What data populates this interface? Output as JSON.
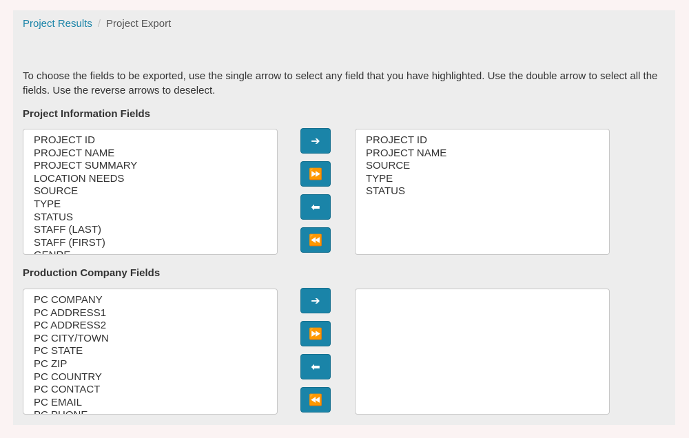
{
  "breadcrumb": {
    "parent": "Project Results",
    "separator": "/",
    "current": "Project Export"
  },
  "instructions": "To choose the fields to be exported, use the single arrow to select any field that you have highlighted. Use the double arrow to select all the fields. Use the reverse arrows to deselect.",
  "project_section": {
    "heading": "Project Information Fields",
    "available": [
      "PROJECT ID",
      "PROJECT NAME",
      "PROJECT SUMMARY",
      "LOCATION NEEDS",
      "SOURCE",
      "TYPE",
      "STATUS",
      "STAFF (LAST)",
      "STAFF (FIRST)",
      "GENRE"
    ],
    "selected": [
      "PROJECT ID",
      "PROJECT NAME",
      "SOURCE",
      "TYPE",
      "STATUS"
    ]
  },
  "company_section": {
    "heading": "Production Company Fields",
    "available": [
      "PC COMPANY",
      "PC ADDRESS1",
      "PC ADDRESS2",
      "PC CITY/TOWN",
      "PC STATE",
      "PC ZIP",
      "PC COUNTRY",
      "PC CONTACT",
      "PC EMAIL",
      "PC PHONE"
    ],
    "selected": []
  },
  "buttons": {
    "add_one_icon": "arrow-right-icon",
    "add_all_icon": "double-chevron-right-icon",
    "remove_one_icon": "arrow-left-icon",
    "remove_all_icon": "double-chevron-left-icon",
    "add_one_glyph": "➔",
    "add_all_glyph": "⏩",
    "remove_one_glyph": "⬅",
    "remove_all_glyph": "⏪"
  },
  "colors": {
    "accent": "#1a84a8",
    "panel_background": "#ededed",
    "page_background": "#fbf3f3"
  }
}
